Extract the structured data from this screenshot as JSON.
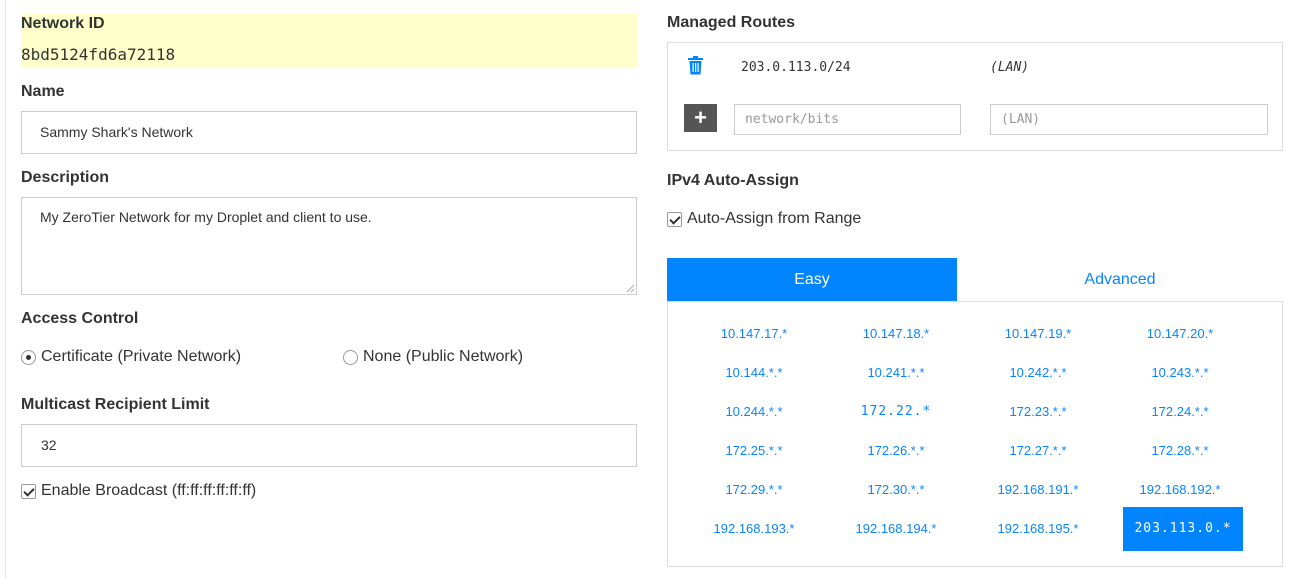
{
  "network_id": {
    "label": "Network ID",
    "value": "8bd5124fd6a72118"
  },
  "name": {
    "label": "Name",
    "value": "Sammy Shark's Network"
  },
  "description": {
    "label": "Description",
    "value": "My ZeroTier Network for my Droplet and client to use."
  },
  "access_control": {
    "label": "Access Control",
    "options": [
      {
        "label": "Certificate (Private Network)",
        "selected": true
      },
      {
        "label": "None (Public Network)",
        "selected": false
      }
    ]
  },
  "multicast": {
    "label": "Multicast Recipient Limit",
    "value": "32"
  },
  "broadcast": {
    "label": "Enable Broadcast (ff:ff:ff:ff:ff:ff)",
    "checked": true
  },
  "managed_routes": {
    "label": "Managed Routes",
    "routes": [
      {
        "target": "203.0.113.0/24",
        "via": "(LAN)"
      }
    ],
    "new_target_placeholder": "network/bits",
    "new_via_placeholder": "(LAN)",
    "add_label": "+"
  },
  "ipv4": {
    "label": "IPv4 Auto-Assign",
    "auto_assign_label": "Auto-Assign from Range",
    "auto_assign_checked": true,
    "tabs": [
      "Easy",
      "Advanced"
    ],
    "active_tab": "Easy",
    "ranges": [
      [
        "10.147.17.*",
        "10.147.18.*",
        "10.147.19.*",
        "10.147.20.*"
      ],
      [
        "10.144.*.*",
        "10.241.*.*",
        "10.242.*.*",
        "10.243.*.*"
      ],
      [
        "10.244.*.*",
        "172.22.*",
        "172.23.*.*",
        "172.24.*.*"
      ],
      [
        "172.25.*.*",
        "172.26.*.*",
        "172.27.*.*",
        "172.28.*.*"
      ],
      [
        "172.29.*.*",
        "172.30.*.*",
        "192.168.191.*",
        "192.168.192.*"
      ],
      [
        "192.168.193.*",
        "192.168.194.*",
        "192.168.195.*",
        "203.113.0.*"
      ]
    ],
    "selected_range": "203.113.0.*"
  },
  "colors": {
    "accent": "#0085ff",
    "highlight": "#ffffcc"
  }
}
